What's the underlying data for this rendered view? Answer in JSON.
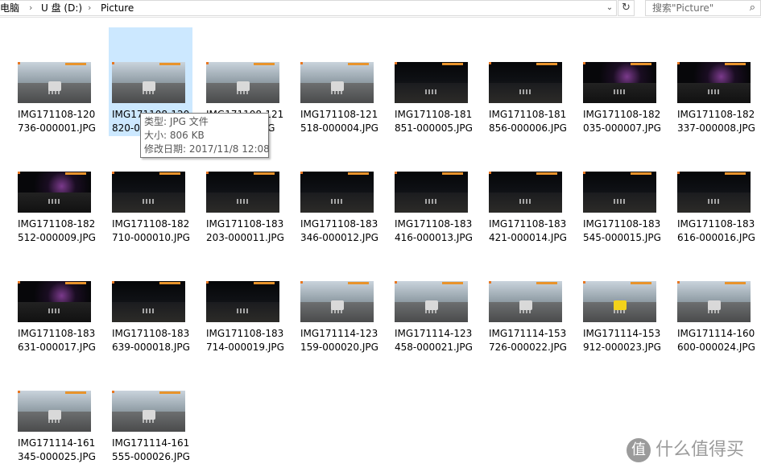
{
  "address": {
    "crumbs": [
      "电脑",
      "U 盘 (D:)",
      "Picture"
    ],
    "separator": "›",
    "dropdown_icon": "⌄",
    "refresh_icon": "↻"
  },
  "search": {
    "placeholder": "搜索\"Picture\"",
    "icon": "⌕"
  },
  "files": [
    {
      "name1": "IMG171108-120",
      "name2": "736-000001.JPG",
      "scene": "day"
    },
    {
      "name1": "IMG171108-120",
      "name2": "820-000002.JPG",
      "scene": "day",
      "selected": true
    },
    {
      "name1": "IMG171108-121",
      "name2": "...-000003.JPG",
      "scene": "day"
    },
    {
      "name1": "IMG171108-121",
      "name2": "518-000004.JPG",
      "scene": "day"
    },
    {
      "name1": "IMG171108-181",
      "name2": "851-000005.JPG",
      "scene": "night"
    },
    {
      "name1": "IMG171108-181",
      "name2": "856-000006.JPG",
      "scene": "night"
    },
    {
      "name1": "IMG171108-182",
      "name2": "035-000007.JPG",
      "scene": "night-lights"
    },
    {
      "name1": "IMG171108-182",
      "name2": "337-000008.JPG",
      "scene": "night-lights"
    },
    {
      "name1": "IMG171108-182",
      "name2": "512-000009.JPG",
      "scene": "night-lights"
    },
    {
      "name1": "IMG171108-182",
      "name2": "710-000010.JPG",
      "scene": "night"
    },
    {
      "name1": "IMG171108-183",
      "name2": "203-000011.JPG",
      "scene": "night"
    },
    {
      "name1": "IMG171108-183",
      "name2": "346-000012.JPG",
      "scene": "night"
    },
    {
      "name1": "IMG171108-183",
      "name2": "416-000013.JPG",
      "scene": "night"
    },
    {
      "name1": "IMG171108-183",
      "name2": "421-000014.JPG",
      "scene": "night"
    },
    {
      "name1": "IMG171108-183",
      "name2": "545-000015.JPG",
      "scene": "night"
    },
    {
      "name1": "IMG171108-183",
      "name2": "616-000016.JPG",
      "scene": "night"
    },
    {
      "name1": "IMG171108-183",
      "name2": "631-000017.JPG",
      "scene": "night-lights"
    },
    {
      "name1": "IMG171108-183",
      "name2": "639-000018.JPG",
      "scene": "night"
    },
    {
      "name1": "IMG171108-183",
      "name2": "714-000019.JPG",
      "scene": "night"
    },
    {
      "name1": "IMG171114-123",
      "name2": "159-000020.JPG",
      "scene": "day"
    },
    {
      "name1": "IMG171114-123",
      "name2": "458-000021.JPG",
      "scene": "day"
    },
    {
      "name1": "IMG171114-153",
      "name2": "726-000022.JPG",
      "scene": "day"
    },
    {
      "name1": "IMG171114-153",
      "name2": "912-000023.JPG",
      "scene": "day-bus"
    },
    {
      "name1": "IMG171114-160",
      "name2": "600-000024.JPG",
      "scene": "day"
    },
    {
      "name1": "IMG171114-161",
      "name2": "345-000025.JPG",
      "scene": "day"
    },
    {
      "name1": "IMG171114-161",
      "name2": "555-000026.JPG",
      "scene": "day"
    }
  ],
  "tooltip": {
    "type_line": "类型: JPG 文件",
    "size_line": "大小: 806 KB",
    "date_line": "修改日期: 2017/11/8 12:08"
  },
  "watermark": {
    "logo_glyph": "值",
    "text": "什么值得买"
  }
}
